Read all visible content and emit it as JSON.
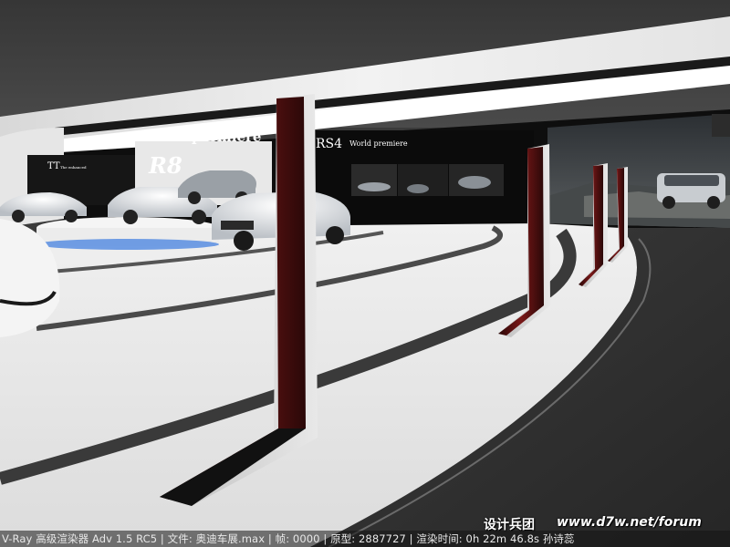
{
  "scene": {
    "signs": {
      "world_premiere_banner": "World premiere",
      "r8_label": "R8",
      "rs4_label": "RS4",
      "rs4_subtitle": "World premiere",
      "tt_label": "TT",
      "tt_subtitle": "The enhanced"
    },
    "colors": {
      "ceiling": "#3a3a3a",
      "floor": "#e6e6e6",
      "pillar_red": "#6b1515",
      "wall_dark": "#0e0e0e"
    }
  },
  "watermark": {
    "group_name": "设计兵团",
    "url": "www.d7w.net/forum"
  },
  "render_status": {
    "text": "V-Ray 高级渲染器 Adv 1.5 RC5 | 文件: 奥迪车展.max | 帧: 0000 | 原型: 2887727 | 渲染时间: 0h 22m 46.8s  孙诗蕊"
  }
}
